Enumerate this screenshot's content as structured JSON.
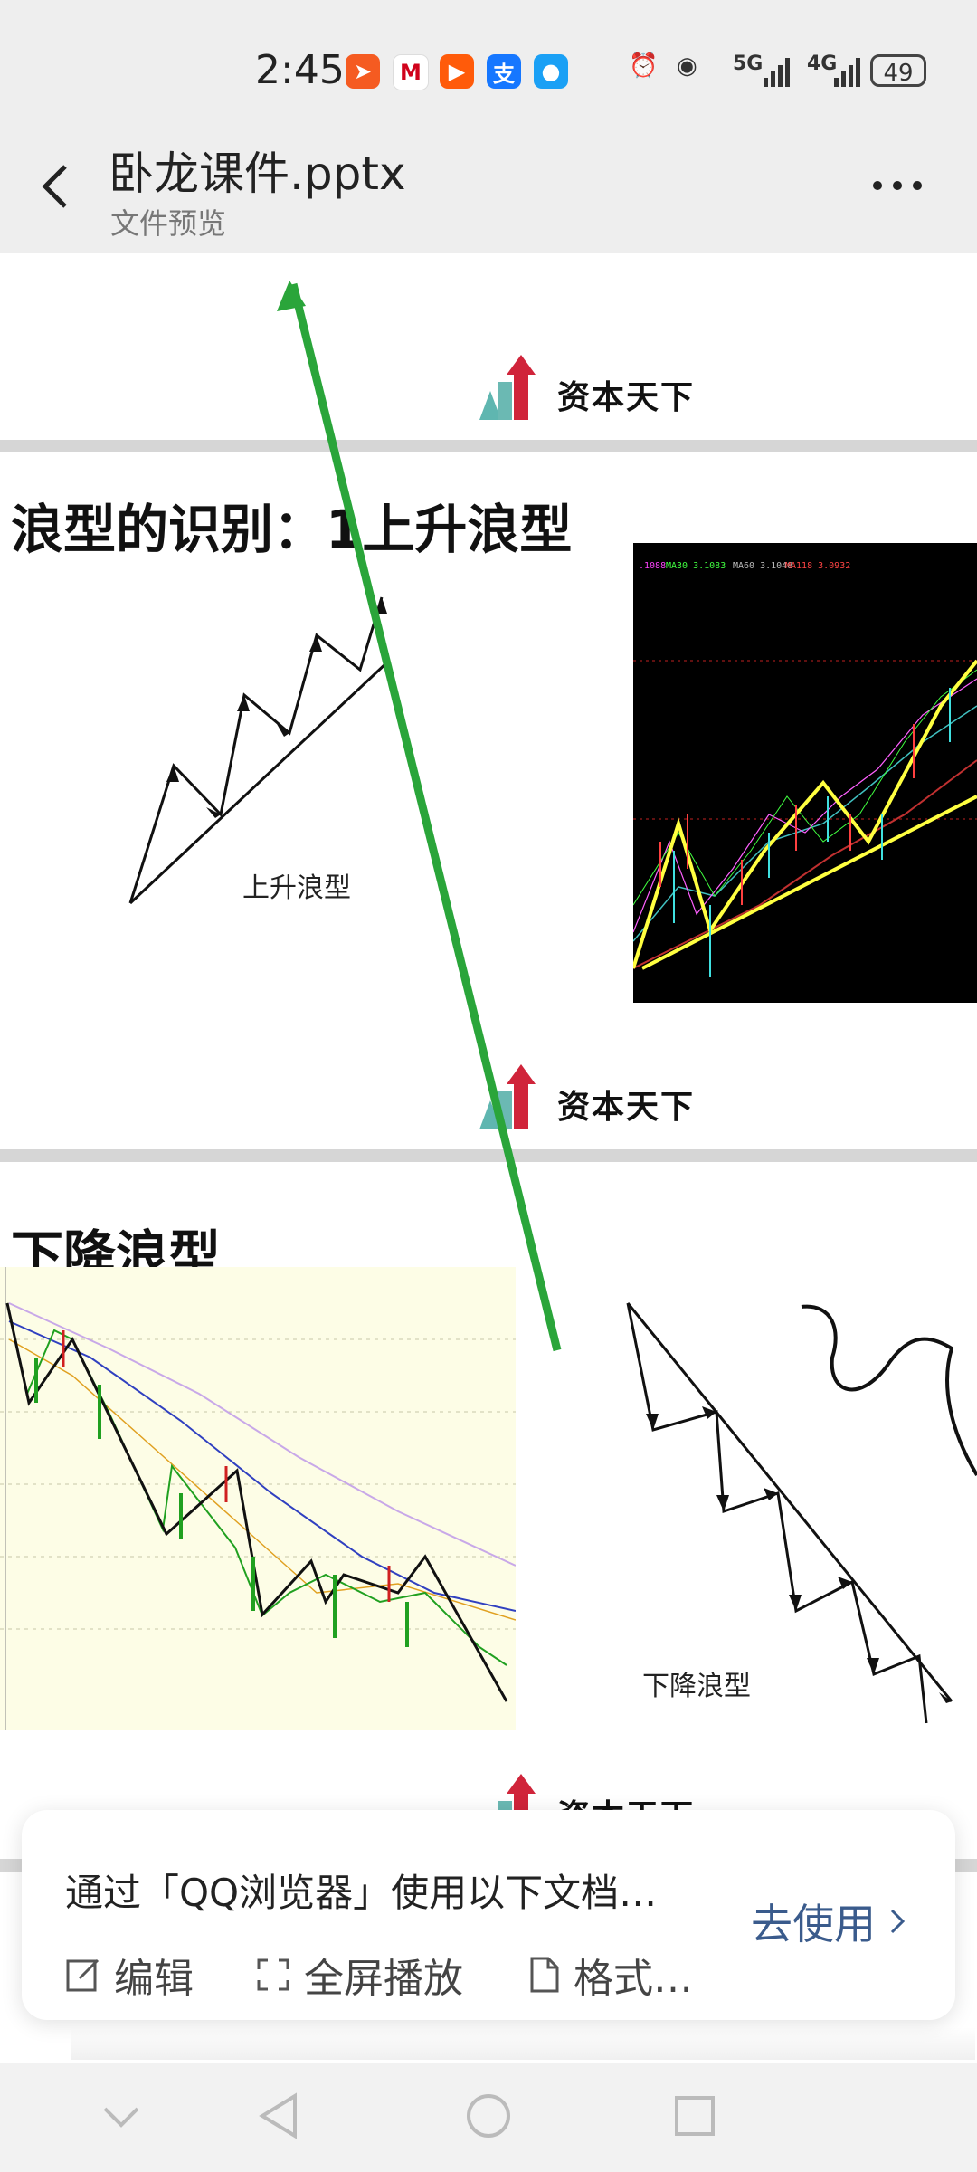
{
  "status_bar": {
    "time": "2:45",
    "notifications": [
      {
        "name": "send-app-icon",
        "color": "#f55b21",
        "glyph": "➤"
      },
      {
        "name": "securities-app-icon",
        "color": "#ffffff",
        "glyph": "M"
      },
      {
        "name": "kuaishou-app-icon",
        "color": "#ff5b0a",
        "glyph": "▶"
      },
      {
        "name": "alipay-app-icon",
        "color": "#1677ff",
        "glyph": "支"
      },
      {
        "name": "chat-app-icon",
        "color": "#1aa0f5",
        "glyph": "💬"
      }
    ],
    "signal_5g": "5G",
    "signal_4g": "4G",
    "battery": "49"
  },
  "header": {
    "title": "卧龙课件.pptx",
    "subtitle": "文件预览"
  },
  "slides": {
    "logo_text": "资本天下",
    "slide2_title": "浪型的识别：1上升浪型",
    "slide2_caption": "上升浪型",
    "slide3_title": "下降浪型",
    "slide3_caption": "下降浪型"
  },
  "promo": {
    "text": "通过「QQ浏览器」使用以下文档…",
    "actions": [
      "编辑",
      "全屏播放",
      "格式…"
    ],
    "use_label": "去使用"
  },
  "colors": {
    "annotation_arrow": "#2aa53a",
    "accent_blue": "#3a5b8c"
  }
}
